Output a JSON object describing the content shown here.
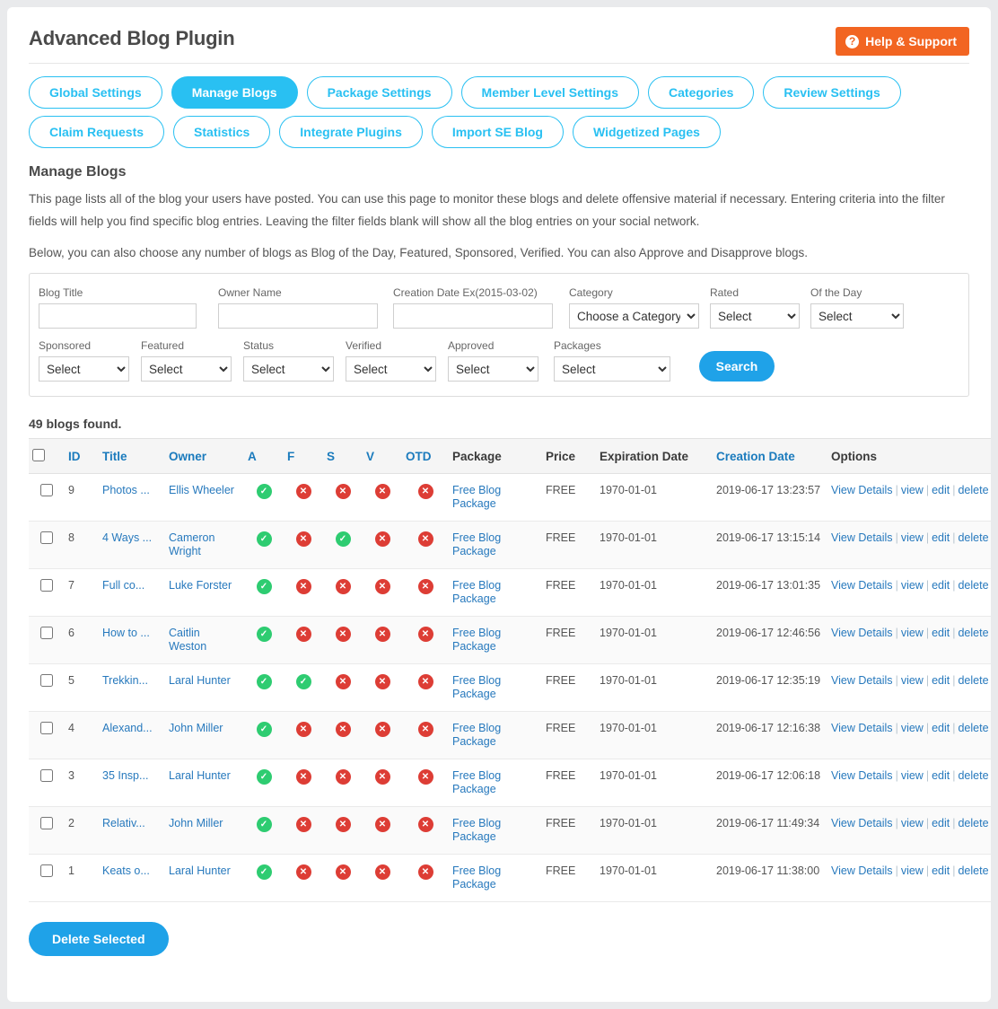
{
  "header": {
    "title": "Advanced Blog Plugin",
    "help_button": "Help & Support",
    "help_icon": "question-circle-icon"
  },
  "tabs": [
    {
      "label": "Global Settings",
      "active": false
    },
    {
      "label": "Manage Blogs",
      "active": true
    },
    {
      "label": "Package Settings",
      "active": false
    },
    {
      "label": "Member Level Settings",
      "active": false
    },
    {
      "label": "Categories",
      "active": false
    },
    {
      "label": "Review Settings",
      "active": false
    },
    {
      "label": "Claim Requests",
      "active": false
    },
    {
      "label": "Statistics",
      "active": false
    },
    {
      "label": "Integrate Plugins",
      "active": false
    },
    {
      "label": "Import SE Blog",
      "active": false
    },
    {
      "label": "Widgetized Pages",
      "active": false
    }
  ],
  "intro": {
    "heading": "Manage Blogs",
    "paragraph1": "This page lists all of the blog your users have posted. You can use this page to monitor these blogs and delete offensive material if necessary. Entering criteria into the filter fields will help you find specific blog entries. Leaving the filter fields blank will show all the blog entries on your social network.",
    "paragraph2": "Below, you can also choose any number of blogs as Blog of the Day, Featured, Sponsored, Verified. You can also Approve and Disapprove blogs."
  },
  "filters": {
    "blog_title": {
      "label": "Blog Title",
      "value": "",
      "placeholder": ""
    },
    "owner_name": {
      "label": "Owner Name",
      "value": "",
      "placeholder": ""
    },
    "creation_date": {
      "label": "Creation Date Ex(2015-03-02)",
      "value": "",
      "placeholder": ""
    },
    "category": {
      "label": "Category",
      "value": "Choose a Category",
      "options": [
        "Choose a Category"
      ]
    },
    "rated": {
      "label": "Rated",
      "value": "Select",
      "options": [
        "Select"
      ]
    },
    "of_the_day": {
      "label": "Of the Day",
      "value": "Select",
      "options": [
        "Select"
      ]
    },
    "sponsored": {
      "label": "Sponsored",
      "value": "Select",
      "options": [
        "Select"
      ]
    },
    "featured": {
      "label": "Featured",
      "value": "Select",
      "options": [
        "Select"
      ]
    },
    "status": {
      "label": "Status",
      "value": "Select",
      "options": [
        "Select"
      ]
    },
    "verified": {
      "label": "Verified",
      "value": "Select",
      "options": [
        "Select"
      ]
    },
    "approved": {
      "label": "Approved",
      "value": "Select",
      "options": [
        "Select"
      ]
    },
    "packages": {
      "label": "Packages",
      "value": "Select",
      "options": [
        "Select"
      ]
    },
    "search_button": "Search"
  },
  "results": {
    "count_text": "49 blogs found.",
    "columns": {
      "id": "ID",
      "title": "Title",
      "owner": "Owner",
      "a": "A",
      "f": "F",
      "s": "S",
      "v": "V",
      "otd": "OTD",
      "package": "Package",
      "price": "Price",
      "expiration_date": "Expiration Date",
      "creation_date": "Creation Date",
      "options": "Options"
    },
    "option_links": {
      "view_details": "View Details",
      "view": "view",
      "edit": "edit",
      "delete": "delete",
      "separator": "|"
    },
    "rows": [
      {
        "id": "9",
        "title": "Photos ...",
        "owner": "Ellis Wheeler",
        "a": true,
        "f": false,
        "s": false,
        "v": false,
        "otd": false,
        "package": "Free Blog Package",
        "price": "FREE",
        "expiration": "1970-01-01",
        "creation": "2019-06-17 13:23:57"
      },
      {
        "id": "8",
        "title": "4 Ways ...",
        "owner": "Cameron Wright",
        "a": true,
        "f": false,
        "s": true,
        "v": false,
        "otd": false,
        "package": "Free Blog Package",
        "price": "FREE",
        "expiration": "1970-01-01",
        "creation": "2019-06-17 13:15:14"
      },
      {
        "id": "7",
        "title": "Full co...",
        "owner": "Luke Forster",
        "a": true,
        "f": false,
        "s": false,
        "v": false,
        "otd": false,
        "package": "Free Blog Package",
        "price": "FREE",
        "expiration": "1970-01-01",
        "creation": "2019-06-17 13:01:35"
      },
      {
        "id": "6",
        "title": "How to ...",
        "owner": "Caitlin Weston",
        "a": true,
        "f": false,
        "s": false,
        "v": false,
        "otd": false,
        "package": "Free Blog Package",
        "price": "FREE",
        "expiration": "1970-01-01",
        "creation": "2019-06-17 12:46:56"
      },
      {
        "id": "5",
        "title": "Trekkin...",
        "owner": "Laral Hunter",
        "a": true,
        "f": true,
        "s": false,
        "v": false,
        "otd": false,
        "package": "Free Blog Package",
        "price": "FREE",
        "expiration": "1970-01-01",
        "creation": "2019-06-17 12:35:19"
      },
      {
        "id": "4",
        "title": "Alexand...",
        "owner": "John Miller",
        "a": true,
        "f": false,
        "s": false,
        "v": false,
        "otd": false,
        "package": "Free Blog Package",
        "price": "FREE",
        "expiration": "1970-01-01",
        "creation": "2019-06-17 12:16:38"
      },
      {
        "id": "3",
        "title": "35 Insp...",
        "owner": "Laral Hunter",
        "a": true,
        "f": false,
        "s": false,
        "v": false,
        "otd": false,
        "package": "Free Blog Package",
        "price": "FREE",
        "expiration": "1970-01-01",
        "creation": "2019-06-17 12:06:18"
      },
      {
        "id": "2",
        "title": "Relativ...",
        "owner": "John Miller",
        "a": true,
        "f": false,
        "s": false,
        "v": false,
        "otd": false,
        "package": "Free Blog Package",
        "price": "FREE",
        "expiration": "1970-01-01",
        "creation": "2019-06-17 11:49:34"
      },
      {
        "id": "1",
        "title": "Keats o...",
        "owner": "Laral Hunter",
        "a": true,
        "f": false,
        "s": false,
        "v": false,
        "otd": false,
        "package": "Free Blog Package",
        "price": "FREE",
        "expiration": "1970-01-01",
        "creation": "2019-06-17 11:38:00"
      }
    ]
  },
  "footer": {
    "delete_selected": "Delete Selected"
  },
  "colors": {
    "accent_cyan": "#29c0f2",
    "button_blue": "#1fa2e8",
    "help_orange": "#f26522",
    "link_blue": "#2779bd",
    "yes_green": "#2ecc71",
    "no_red": "#dd3d35"
  }
}
